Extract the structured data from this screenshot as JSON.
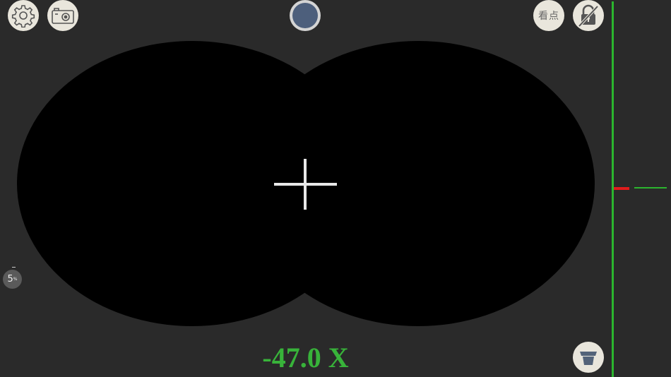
{
  "toolbar": {
    "settings_icon": "gear-icon",
    "camera_icon": "camera-icon",
    "view_point_label": "看点",
    "lock_icon": "lock-off-icon",
    "funnel_icon": "funnel-icon"
  },
  "shutter": {
    "icon": "shutter-icon",
    "color": "#4d5f7c"
  },
  "viewport": {
    "reading": "-47.0 X",
    "reading_color": "#38b33a"
  },
  "zoom": {
    "value": "5",
    "unit": "%"
  },
  "level_indicator": {
    "rail_color": "#2bb52e",
    "marker_color": "#e01b1b"
  }
}
